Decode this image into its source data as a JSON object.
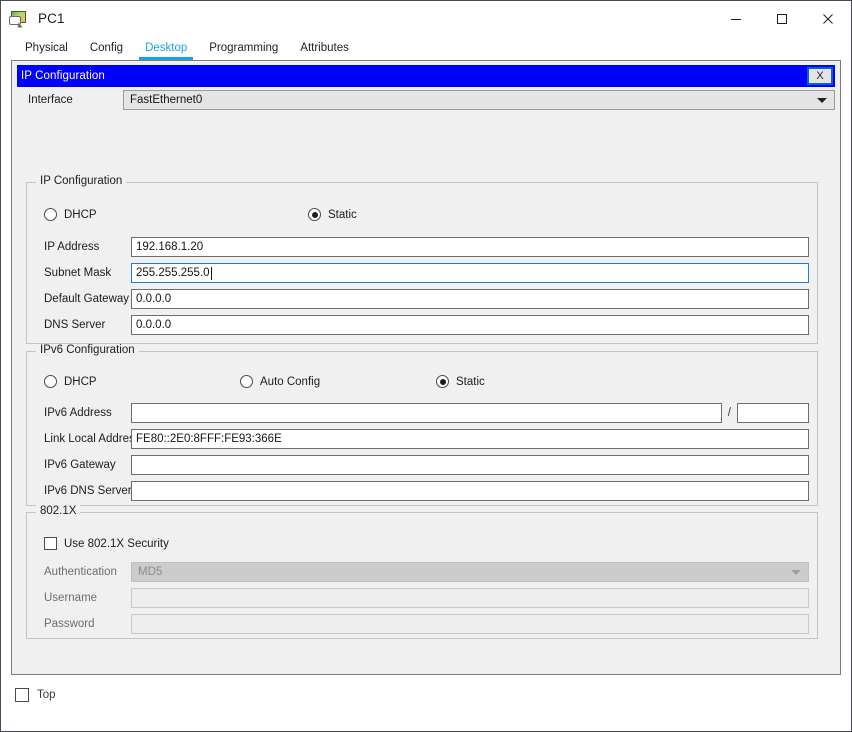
{
  "window": {
    "title": "PC1",
    "icon": "packet-tracer-device-icon",
    "controls": {
      "minimize": "minimize-icon",
      "maximize": "maximize-icon",
      "close": "close-icon"
    }
  },
  "tabs": [
    {
      "label": "Physical",
      "active": false
    },
    {
      "label": "Config",
      "active": false
    },
    {
      "label": "Desktop",
      "active": true
    },
    {
      "label": "Programming",
      "active": false
    },
    {
      "label": "Attributes",
      "active": false
    }
  ],
  "dialog": {
    "title": "IP Configuration",
    "close_label": "X",
    "accent_color": "#0000ff",
    "tab_accent_color": "#1aa3e0"
  },
  "interface": {
    "label": "Interface",
    "value": "FastEthernet0"
  },
  "ip_config": {
    "group_title": "IP Configuration",
    "mode": {
      "dhcp": {
        "label": "DHCP",
        "selected": false
      },
      "static": {
        "label": "Static",
        "selected": true
      }
    },
    "fields": [
      {
        "label": "IP Address",
        "value": "192.168.1.20",
        "focused": false
      },
      {
        "label": "Subnet Mask",
        "value": "255.255.255.0",
        "focused": true
      },
      {
        "label": "Default Gateway",
        "value": "0.0.0.0",
        "focused": false
      },
      {
        "label": "DNS Server",
        "value": "0.0.0.0",
        "focused": false
      }
    ]
  },
  "ipv6_config": {
    "group_title": "IPv6 Configuration",
    "mode": {
      "dhcp": {
        "label": "DHCP",
        "selected": false
      },
      "auto_config": {
        "label": "Auto Config",
        "selected": false
      },
      "static": {
        "label": "Static",
        "selected": true
      }
    },
    "address": {
      "label": "IPv6 Address",
      "value": "",
      "separator": "/",
      "prefix_value": ""
    },
    "fields": [
      {
        "label": "Link Local Address",
        "value": "FE80::2E0:8FFF:FE93:366E"
      },
      {
        "label": "IPv6 Gateway",
        "value": ""
      },
      {
        "label": "IPv6 DNS Server",
        "value": ""
      }
    ]
  },
  "dot1x": {
    "group_title": "802.1X",
    "use_security": {
      "label": "Use 802.1X Security",
      "checked": false
    },
    "authentication": {
      "label": "Authentication",
      "value": "MD5",
      "disabled": true
    },
    "username": {
      "label": "Username",
      "value": "",
      "disabled": true
    },
    "password": {
      "label": "Password",
      "value": "",
      "disabled": true
    }
  },
  "footer": {
    "top_checkbox": {
      "label": "Top",
      "checked": false
    }
  }
}
